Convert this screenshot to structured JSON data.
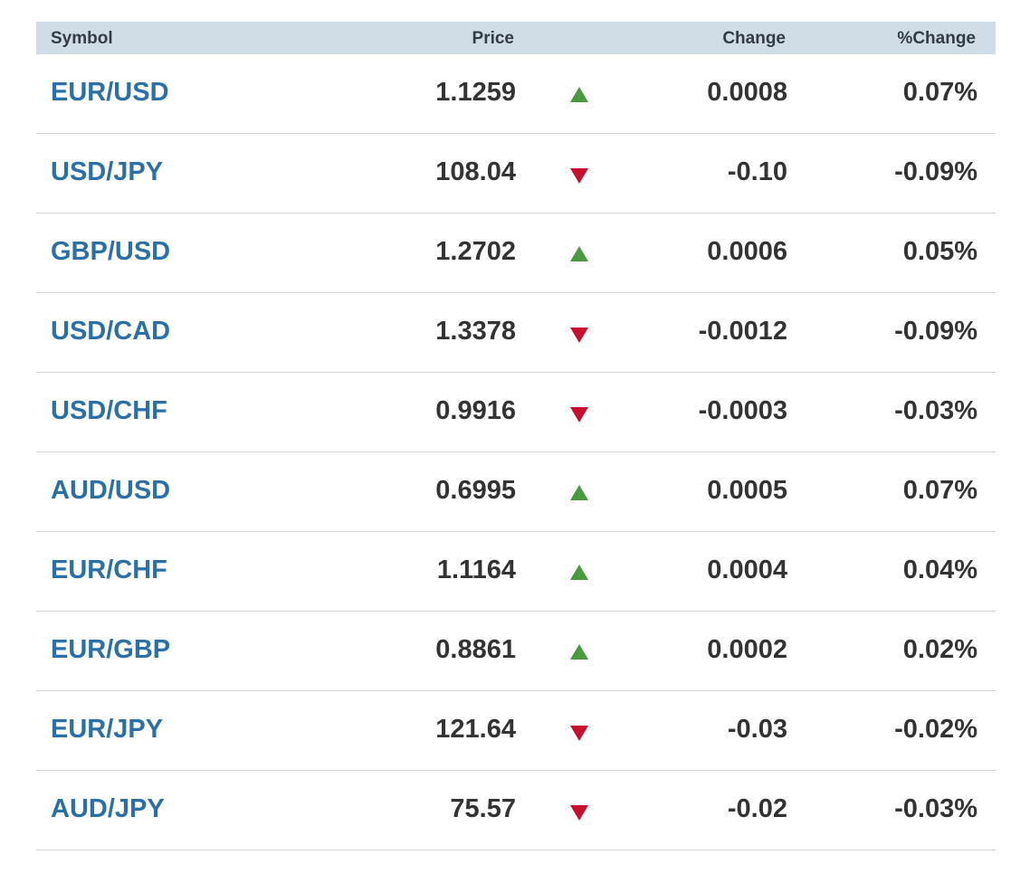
{
  "header": {
    "symbol": "Symbol",
    "price": "Price",
    "change": "Change",
    "pct_change": "%Change"
  },
  "colors": {
    "header_bg": "#d1dde6",
    "symbol_link": "#2b6fa8",
    "up": "#4a9a3e",
    "down": "#c8102e"
  },
  "rows": [
    {
      "symbol": "EUR/USD",
      "price": "1.1259",
      "direction": "up",
      "direction_icon": "triangle-up-icon",
      "change": "0.0008",
      "pct_change": "0.07%"
    },
    {
      "symbol": "USD/JPY",
      "price": "108.04",
      "direction": "down",
      "direction_icon": "triangle-down-icon",
      "change": "-0.10",
      "pct_change": "-0.09%"
    },
    {
      "symbol": "GBP/USD",
      "price": "1.2702",
      "direction": "up",
      "direction_icon": "triangle-up-icon",
      "change": "0.0006",
      "pct_change": "0.05%"
    },
    {
      "symbol": "USD/CAD",
      "price": "1.3378",
      "direction": "down",
      "direction_icon": "triangle-down-icon",
      "change": "-0.0012",
      "pct_change": "-0.09%"
    },
    {
      "symbol": "USD/CHF",
      "price": "0.9916",
      "direction": "down",
      "direction_icon": "triangle-down-icon",
      "change": "-0.0003",
      "pct_change": "-0.03%"
    },
    {
      "symbol": "AUD/USD",
      "price": "0.6995",
      "direction": "up",
      "direction_icon": "triangle-up-icon",
      "change": "0.0005",
      "pct_change": "0.07%"
    },
    {
      "symbol": "EUR/CHF",
      "price": "1.1164",
      "direction": "up",
      "direction_icon": "triangle-up-icon",
      "change": "0.0004",
      "pct_change": "0.04%"
    },
    {
      "symbol": "EUR/GBP",
      "price": "0.8861",
      "direction": "up",
      "direction_icon": "triangle-up-icon",
      "change": "0.0002",
      "pct_change": "0.02%"
    },
    {
      "symbol": "EUR/JPY",
      "price": "121.64",
      "direction": "down",
      "direction_icon": "triangle-down-icon",
      "change": "-0.03",
      "pct_change": "-0.02%"
    },
    {
      "symbol": "AUD/JPY",
      "price": "75.57",
      "direction": "down",
      "direction_icon": "triangle-down-icon",
      "change": "-0.02",
      "pct_change": "-0.03%"
    }
  ]
}
